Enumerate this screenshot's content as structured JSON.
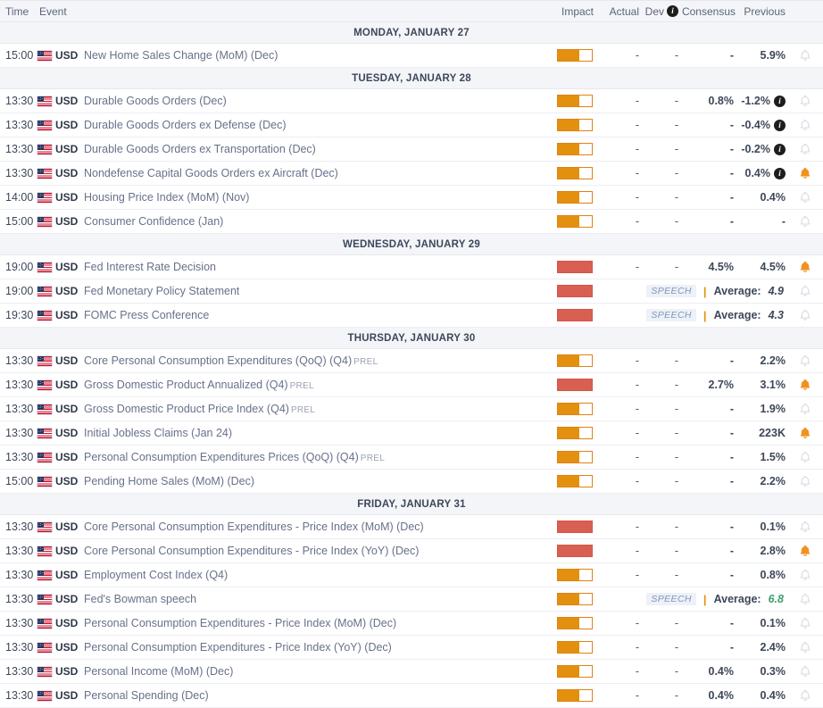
{
  "header": {
    "time": "Time",
    "event": "Event",
    "impact": "Impact",
    "actual": "Actual",
    "dev": "Dev",
    "dev_info_icon": "info-icon",
    "consensus": "Consensus",
    "previous": "Previous"
  },
  "colors": {
    "impact_medium": "#e3900f",
    "impact_high": "#d85f52",
    "bell_active": "#f0921e",
    "bell_inactive": "#d7dbe2",
    "event_text": "#67718a",
    "speech_tag_text": "#7f96bf",
    "green_value": "#3f9e6e",
    "day_header_bg": "#f4f5f9"
  },
  "days": [
    {
      "label": "MONDAY, JANUARY 27",
      "events": [
        {
          "time": "15:00",
          "currency": "USD",
          "flag": "us-flag-icon",
          "name": "New Home Sales Change (MoM) (Dec)",
          "prel": "",
          "impact": 2,
          "actual": "-",
          "dev": "-",
          "dev_info": false,
          "consensus": "-",
          "previous": "5.9%",
          "alert": false,
          "speech": null
        }
      ]
    },
    {
      "label": "TUESDAY, JANUARY 28",
      "events": [
        {
          "time": "13:30",
          "currency": "USD",
          "flag": "us-flag-icon",
          "name": "Durable Goods Orders (Dec)",
          "prel": "",
          "impact": 2,
          "actual": "-",
          "dev": "-",
          "dev_info": false,
          "consensus": "0.8%",
          "previous": "-1.2%",
          "info": true,
          "alert": false,
          "speech": null
        },
        {
          "time": "13:30",
          "currency": "USD",
          "flag": "us-flag-icon",
          "name": "Durable Goods Orders ex Defense (Dec)",
          "prel": "",
          "impact": 2,
          "actual": "-",
          "dev": "-",
          "dev_info": false,
          "consensus": "-",
          "previous": "-0.4%",
          "info": true,
          "alert": false,
          "speech": null
        },
        {
          "time": "13:30",
          "currency": "USD",
          "flag": "us-flag-icon",
          "name": "Durable Goods Orders ex Transportation (Dec)",
          "prel": "",
          "impact": 2,
          "actual": "-",
          "dev": "-",
          "dev_info": false,
          "consensus": "-",
          "previous": "-0.2%",
          "info": true,
          "alert": false,
          "speech": null
        },
        {
          "time": "13:30",
          "currency": "USD",
          "flag": "us-flag-icon",
          "name": "Nondefense Capital Goods Orders ex Aircraft (Dec)",
          "prel": "",
          "impact": 2,
          "actual": "-",
          "dev": "-",
          "dev_info": false,
          "consensus": "-",
          "previous": "0.4%",
          "info": true,
          "alert": true,
          "speech": null
        },
        {
          "time": "14:00",
          "currency": "USD",
          "flag": "us-flag-icon",
          "name": "Housing Price Index (MoM) (Nov)",
          "prel": "",
          "impact": 2,
          "actual": "-",
          "dev": "-",
          "dev_info": false,
          "consensus": "-",
          "previous": "0.4%",
          "alert": false,
          "speech": null
        },
        {
          "time": "15:00",
          "currency": "USD",
          "flag": "us-flag-icon",
          "name": "Consumer Confidence (Jan)",
          "prel": "",
          "impact": 2,
          "actual": "-",
          "dev": "-",
          "dev_info": false,
          "consensus": "-",
          "previous": "-",
          "alert": false,
          "speech": null
        }
      ]
    },
    {
      "label": "WEDNESDAY, JANUARY 29",
      "events": [
        {
          "time": "19:00",
          "currency": "USD",
          "flag": "us-flag-icon",
          "name": "Fed Interest Rate Decision",
          "prel": "",
          "impact": 3,
          "actual": "-",
          "dev": "-",
          "dev_info": false,
          "consensus": "4.5%",
          "previous": "4.5%",
          "alert": true,
          "speech": null
        },
        {
          "time": "19:00",
          "currency": "USD",
          "flag": "us-flag-icon",
          "name": "Fed Monetary Policy Statement",
          "prel": "",
          "impact": 3,
          "alert": false,
          "speech": {
            "tag": "SPEECH",
            "label": "Average:",
            "value": "4.9",
            "green": false
          }
        },
        {
          "time": "19:30",
          "currency": "USD",
          "flag": "us-flag-icon",
          "name": "FOMC Press Conference",
          "prel": "",
          "impact": 3,
          "alert": false,
          "speech": {
            "tag": "SPEECH",
            "label": "Average:",
            "value": "4.3",
            "green": false
          }
        }
      ]
    },
    {
      "label": "THURSDAY, JANUARY 30",
      "events": [
        {
          "time": "13:30",
          "currency": "USD",
          "flag": "us-flag-icon",
          "name": "Core Personal Consumption Expenditures (QoQ) (Q4)",
          "prel": "PREL",
          "impact": 2,
          "actual": "-",
          "dev": "-",
          "dev_info": false,
          "consensus": "-",
          "previous": "2.2%",
          "alert": false,
          "speech": null
        },
        {
          "time": "13:30",
          "currency": "USD",
          "flag": "us-flag-icon",
          "name": "Gross Domestic Product Annualized (Q4)",
          "prel": "PREL",
          "impact": 3,
          "actual": "-",
          "dev": "-",
          "dev_info": false,
          "consensus": "2.7%",
          "previous": "3.1%",
          "alert": true,
          "speech": null
        },
        {
          "time": "13:30",
          "currency": "USD",
          "flag": "us-flag-icon",
          "name": "Gross Domestic Product Price Index (Q4)",
          "prel": "PREL",
          "impact": 2,
          "actual": "-",
          "dev": "-",
          "dev_info": false,
          "consensus": "-",
          "previous": "1.9%",
          "alert": false,
          "speech": null
        },
        {
          "time": "13:30",
          "currency": "USD",
          "flag": "us-flag-icon",
          "name": "Initial Jobless Claims (Jan 24)",
          "prel": "",
          "impact": 2,
          "actual": "-",
          "dev": "-",
          "dev_info": false,
          "consensus": "-",
          "previous": "223K",
          "alert": true,
          "speech": null
        },
        {
          "time": "13:30",
          "currency": "USD",
          "flag": "us-flag-icon",
          "name": "Personal Consumption Expenditures Prices (QoQ) (Q4)",
          "prel": "PREL",
          "impact": 2,
          "actual": "-",
          "dev": "-",
          "dev_info": false,
          "consensus": "-",
          "previous": "1.5%",
          "alert": false,
          "speech": null
        },
        {
          "time": "15:00",
          "currency": "USD",
          "flag": "us-flag-icon",
          "name": "Pending Home Sales (MoM) (Dec)",
          "prel": "",
          "impact": 2,
          "actual": "-",
          "dev": "-",
          "dev_info": false,
          "consensus": "-",
          "previous": "2.2%",
          "alert": false,
          "speech": null
        }
      ]
    },
    {
      "label": "FRIDAY, JANUARY 31",
      "events": [
        {
          "time": "13:30",
          "currency": "USD",
          "flag": "us-flag-icon",
          "name": "Core Personal Consumption Expenditures - Price Index (MoM) (Dec)",
          "prel": "",
          "impact": 3,
          "actual": "-",
          "dev": "-",
          "dev_info": false,
          "consensus": "-",
          "previous": "0.1%",
          "alert": false,
          "speech": null
        },
        {
          "time": "13:30",
          "currency": "USD",
          "flag": "us-flag-icon",
          "name": "Core Personal Consumption Expenditures - Price Index (YoY) (Dec)",
          "prel": "",
          "impact": 3,
          "actual": "-",
          "dev": "-",
          "dev_info": false,
          "consensus": "-",
          "previous": "2.8%",
          "alert": true,
          "speech": null
        },
        {
          "time": "13:30",
          "currency": "USD",
          "flag": "us-flag-icon",
          "name": "Employment Cost Index (Q4)",
          "prel": "",
          "impact": 2,
          "actual": "-",
          "dev": "-",
          "dev_info": false,
          "consensus": "-",
          "previous": "0.8%",
          "alert": false,
          "speech": null
        },
        {
          "time": "13:30",
          "currency": "USD",
          "flag": "us-flag-icon",
          "name": "Fed's Bowman speech",
          "prel": "",
          "impact": 2,
          "alert": false,
          "speech": {
            "tag": "SPEECH",
            "label": "Average:",
            "value": "6.8",
            "green": true
          }
        },
        {
          "time": "13:30",
          "currency": "USD",
          "flag": "us-flag-icon",
          "name": "Personal Consumption Expenditures - Price Index (MoM) (Dec)",
          "prel": "",
          "impact": 2,
          "actual": "-",
          "dev": "-",
          "dev_info": false,
          "consensus": "-",
          "previous": "0.1%",
          "alert": false,
          "speech": null
        },
        {
          "time": "13:30",
          "currency": "USD",
          "flag": "us-flag-icon",
          "name": "Personal Consumption Expenditures - Price Index (YoY) (Dec)",
          "prel": "",
          "impact": 2,
          "actual": "-",
          "dev": "-",
          "dev_info": false,
          "consensus": "-",
          "previous": "2.4%",
          "alert": false,
          "speech": null
        },
        {
          "time": "13:30",
          "currency": "USD",
          "flag": "us-flag-icon",
          "name": "Personal Income (MoM) (Dec)",
          "prel": "",
          "impact": 2,
          "actual": "-",
          "dev": "-",
          "dev_info": false,
          "consensus": "0.4%",
          "previous": "0.3%",
          "alert": false,
          "speech": null
        },
        {
          "time": "13:30",
          "currency": "USD",
          "flag": "us-flag-icon",
          "name": "Personal Spending (Dec)",
          "prel": "",
          "impact": 2,
          "actual": "-",
          "dev": "-",
          "dev_info": false,
          "consensus": "0.4%",
          "previous": "0.4%",
          "alert": false,
          "speech": null
        }
      ]
    }
  ]
}
